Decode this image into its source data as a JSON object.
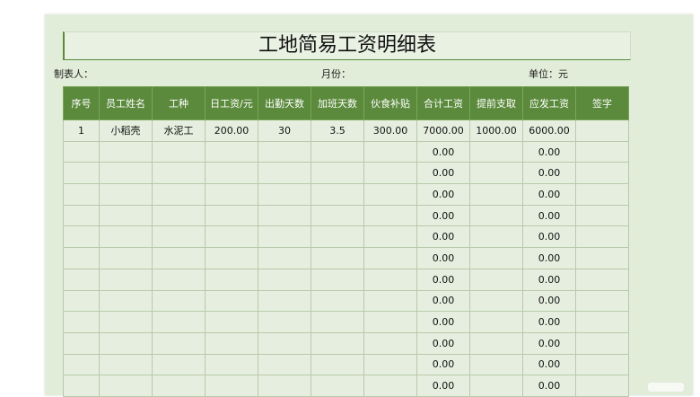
{
  "title": "工地简易工资明细表",
  "meta": {
    "maker_label": "制表人：",
    "month_label": "月份：",
    "unit_label": "单位：元"
  },
  "table": {
    "headers": [
      "序号",
      "员工姓名",
      "工种",
      "日工资/元",
      "出勤天数",
      "加班天数",
      "伙食补贴",
      "合计工资",
      "提前支取",
      "应发工资",
      "签字"
    ],
    "rows": [
      [
        "1",
        "小稻壳",
        "水泥工",
        "200.00",
        "30",
        "3.5",
        "300.00",
        "7000.00",
        "1000.00",
        "6000.00",
        ""
      ],
      [
        "",
        "",
        "",
        "",
        "",
        "",
        "",
        "0.00",
        "",
        "0.00",
        ""
      ],
      [
        "",
        "",
        "",
        "",
        "",
        "",
        "",
        "0.00",
        "",
        "0.00",
        ""
      ],
      [
        "",
        "",
        "",
        "",
        "",
        "",
        "",
        "0.00",
        "",
        "0.00",
        ""
      ],
      [
        "",
        "",
        "",
        "",
        "",
        "",
        "",
        "0.00",
        "",
        "0.00",
        ""
      ],
      [
        "",
        "",
        "",
        "",
        "",
        "",
        "",
        "0.00",
        "",
        "0.00",
        ""
      ],
      [
        "",
        "",
        "",
        "",
        "",
        "",
        "",
        "0.00",
        "",
        "0.00",
        ""
      ],
      [
        "",
        "",
        "",
        "",
        "",
        "",
        "",
        "0.00",
        "",
        "0.00",
        ""
      ],
      [
        "",
        "",
        "",
        "",
        "",
        "",
        "",
        "0.00",
        "",
        "0.00",
        ""
      ],
      [
        "",
        "",
        "",
        "",
        "",
        "",
        "",
        "0.00",
        "",
        "0.00",
        ""
      ],
      [
        "",
        "",
        "",
        "",
        "",
        "",
        "",
        "0.00",
        "",
        "0.00",
        ""
      ],
      [
        "",
        "",
        "",
        "",
        "",
        "",
        "",
        "0.00",
        "",
        "0.00",
        ""
      ],
      [
        "",
        "",
        "",
        "",
        "",
        "",
        "",
        "0.00",
        "",
        "0.00",
        ""
      ]
    ]
  },
  "colors": {
    "header_bg": "#5b8a3c",
    "sheet_bg": "#e1ecd9"
  }
}
